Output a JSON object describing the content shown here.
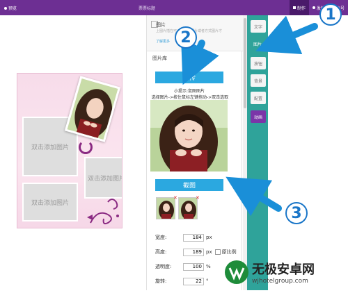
{
  "topbar": {
    "preview": "预览",
    "title": "票票标题",
    "make": "制作",
    "publish": "发帖",
    "account": "账号"
  },
  "canvas": {
    "placeholder_1": "双击添加图片",
    "placeholder_2": "双击添加图片",
    "placeholder_3": "双击添加图片"
  },
  "panel": {
    "header_title": "图片",
    "header_desc": "上图片插在可以当前，照片或者方式图片才",
    "header_more": "了解更多",
    "library_label": "图片库",
    "upload_label": "上传",
    "tip_line1": "小提示:鼠图图片",
    "tip_line2": "选择图片->按住鼠标左键拖动->双击选取",
    "crop_label": "截图",
    "form": {
      "width_label": "宽度:",
      "width_value": "184",
      "width_unit": "px",
      "height_label": "高度:",
      "height_value": "189",
      "height_unit": "px",
      "ratio_label": "原比例",
      "opacity_label": "透明度:",
      "opacity_value": "100",
      "opacity_unit": "%",
      "rotate_label": "旋转:",
      "rotate_value": "22",
      "rotate_unit": "°"
    }
  },
  "tabs": [
    "文字",
    "图片",
    "按钮",
    "背景",
    "配置",
    "动画"
  ],
  "annotations": {
    "n1": "1",
    "n2": "2",
    "n3": "3"
  },
  "watermark": {
    "name": "无极安卓网",
    "url": "wjhotelgroup.com"
  },
  "colors": {
    "topbar": "#6d2f93",
    "accent_blue": "#2ba8e0",
    "tab_teal": "#2fa39a",
    "arrow_blue": "#1a8fd8"
  }
}
